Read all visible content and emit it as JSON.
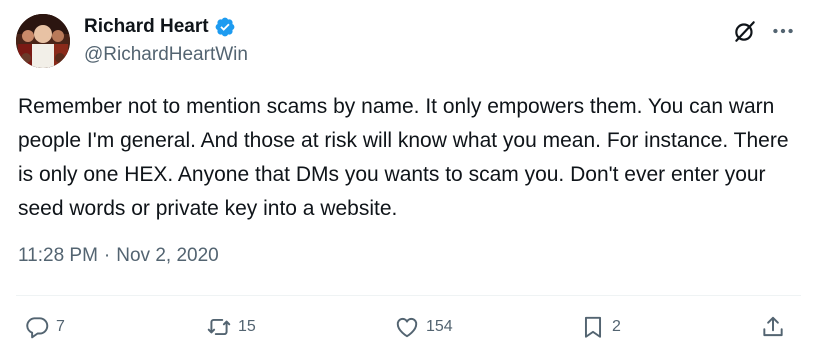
{
  "author": {
    "display_name": "Richard Heart",
    "handle": "@RichardHeartWin"
  },
  "tweet": {
    "text": "Remember not to mention scams by name. It only empowers them. You can warn people I'm general. And those at risk will know what you mean. For instance. There is only one HEX. Anyone that DMs you wants to scam you. Don't ever enter your seed words or private key into a website.",
    "time": "11:28 PM",
    "separator": "·",
    "date": "Nov 2, 2020"
  },
  "actions": {
    "replies": "7",
    "reposts": "15",
    "likes": "154",
    "bookmarks": "2"
  },
  "icons": {
    "verified": "verified-badge-icon",
    "grok": "grok-icon",
    "more": "more-icon",
    "reply": "reply-icon",
    "repost": "repost-icon",
    "like": "heart-icon",
    "bookmark": "bookmark-icon",
    "share": "share-icon"
  },
  "colors": {
    "text": "#0f1419",
    "secondary": "#536471",
    "verified": "#1d9bf0"
  }
}
